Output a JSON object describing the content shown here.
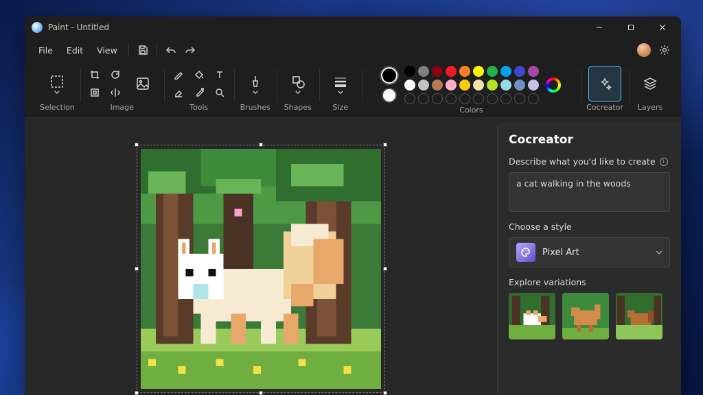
{
  "app_title": "Paint - Untitled",
  "menu": {
    "file": "File",
    "edit": "Edit",
    "view": "View"
  },
  "ribbon": {
    "selection": "Selection",
    "image": "Image",
    "tools": "Tools",
    "brushes": "Brushes",
    "shapes": "Shapes",
    "size": "Size",
    "colors": "Colors",
    "cocreator": "Cocreator",
    "layers": "Layers"
  },
  "colors": {
    "primary": "#000000",
    "secondary": "#ffffff",
    "palette_row1": [
      "#000000",
      "#7f7f7f",
      "#880015",
      "#ed1c24",
      "#ff7f27",
      "#fff200",
      "#22b14c",
      "#00a2e8",
      "#3f48cc",
      "#a349a4"
    ],
    "palette_row2": [
      "#ffffff",
      "#c3c3c3",
      "#b97a57",
      "#ffaec9",
      "#ffc90e",
      "#efe4b0",
      "#b5e61d",
      "#99d9ea",
      "#7092be",
      "#c8bfe7"
    ],
    "custom_slots": 10
  },
  "panel": {
    "title": "Cocreator",
    "describe_label": "Describe what you'd like to create",
    "description_value": "a cat walking in the woods",
    "style_label": "Choose a style",
    "style_selected": "Pixel Art",
    "variations_label": "Explore variations"
  }
}
